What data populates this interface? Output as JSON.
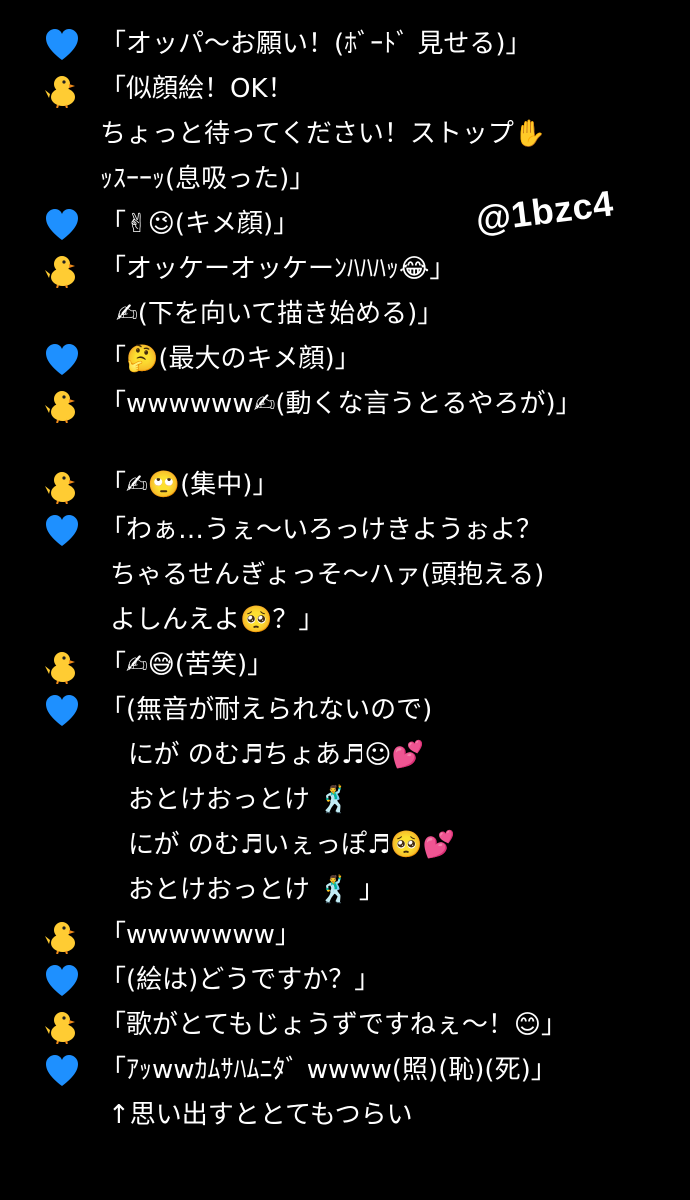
{
  "watermark": "@1bzc4",
  "speakers": {
    "blue": {
      "icon": "blue-heart-icon",
      "color": "#1E90FF"
    },
    "chick": {
      "icon": "chick-icon",
      "color": "#FFCC33"
    }
  },
  "lines": [
    {
      "speaker": "blue",
      "text": "「オッパ〜お願い！(ﾎﾞｰﾄﾞ 見せる)」"
    },
    {
      "speaker": "chick",
      "text": "「似顔絵！OK！"
    },
    {
      "speaker": "",
      "text": "ちょっと待ってください！ストップ✋"
    },
    {
      "speaker": "",
      "text": "ｯｽｰｰｯ(息吸った)」"
    },
    {
      "speaker": "blue",
      "text": "「✌😉(キメ顔)」"
    },
    {
      "speaker": "chick",
      "text": "「オッケーオッケーﾝﾊﾊﾊｯ😂」"
    },
    {
      "speaker": "",
      "text": "✍(下を向いて描き始める)」"
    },
    {
      "speaker": "blue",
      "text": "「🤔(最大のキメ顔)」"
    },
    {
      "speaker": "chick",
      "text": "「wwwwww✍(動くな言うとるやろが)」"
    },
    {
      "speaker": "",
      "text": ""
    },
    {
      "speaker": "chick",
      "text": "「✍🙄(集中)」"
    },
    {
      "speaker": "blue",
      "text": "「わぁ…うぇ〜いろっけきようぉよ？"
    },
    {
      "speaker": "",
      "text": "ちゃるせんぎょっそ〜ハァ(頭抱える)"
    },
    {
      "speaker": "",
      "text": "よしんえよ🥺？」"
    },
    {
      "speaker": "chick",
      "text": "「✍😅(苦笑)」"
    },
    {
      "speaker": "blue",
      "text": "「(無音が耐えられないので)"
    },
    {
      "speaker": "",
      "text": "にが のむ♬ちょあ♬☺💕"
    },
    {
      "speaker": "",
      "text": "おとけおっとけ 🕺"
    },
    {
      "speaker": "",
      "text": "にが のむ♬いぇっぽ♬🥺💕"
    },
    {
      "speaker": "",
      "text": "おとけおっとけ 🕺 」"
    },
    {
      "speaker": "chick",
      "text": "「wwwwwww」"
    },
    {
      "speaker": "blue",
      "text": "「(絵は)どうですか？」"
    },
    {
      "speaker": "chick",
      "text": "「歌がとてもじょうずですねぇ〜！😊」"
    },
    {
      "speaker": "blue",
      "text": "「ｱｯwwｶﾑｻﾊﾑﾆﾀﾞ wwww(照)(恥)(死)」"
    },
    {
      "speaker": "",
      "text": "↑思い出すととてもつらい"
    }
  ]
}
